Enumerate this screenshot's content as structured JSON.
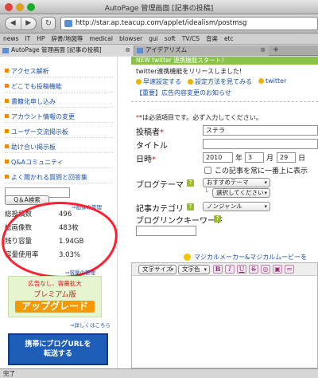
{
  "window": {
    "title": "AutoPage 管理画面 [記事の投稿]"
  },
  "toolbar": {
    "url": "http://star.ap.teacup.com/applet/idealism/postmsg",
    "back": "◀",
    "forward": "▶",
    "reload": "↻"
  },
  "bookmarks": [
    "news",
    "IT",
    "HP",
    "辞書/地図等",
    "medical",
    "blowser",
    "gui",
    "soft",
    "TV/CS",
    "音楽",
    "etc"
  ],
  "tabs": [
    {
      "label": "AutoPage 管理画面 [記事の投稿]",
      "active": true
    },
    {
      "label": "アイデアリズム",
      "active": false
    }
  ],
  "tab_close": "⊗",
  "tab_new": "+",
  "sidebar": {
    "items": [
      "アクセス解析",
      "どこでも投稿機能",
      "書籍化申し込み",
      "アカウント情報の変更",
      "ユーザー交流掲示板",
      "助け合い掲示板",
      "Q&Aコミュニティ",
      "よく聞かれる質問と回答集"
    ],
    "qa_button": "Q＆A検索",
    "back_link": "⇒画像の管理",
    "stats": [
      {
        "label": "総投稿数",
        "value": "496"
      },
      {
        "label": "総画像数",
        "value": "483枚"
      },
      {
        "label": "残り容量",
        "value": "1.94GB"
      },
      {
        "label": "容量使用率",
        "value": "3.03%"
      }
    ],
    "stats_link": "⇒容量の管理",
    "promo": {
      "line1": "広告なし、容量拡大",
      "line2": "プレミアム版",
      "line3": "アップグレード"
    },
    "promo_link": "⇒詳しくはこちら",
    "blue_box": {
      "line1": "携帯にブログURLを",
      "line2": "転送する"
    }
  },
  "main": {
    "twitter_banner": "NEW  twitter  連携機能スタート！",
    "twitter_text": "twitter連携機能をリリースしました!",
    "twitter_links": [
      "早速設定する",
      "設定方法を見てみる",
      "twitter"
    ],
    "notice": "【重要】広告内容変更のお知らせ",
    "required_note": "*は必須項目です。必ず入力してください。",
    "form": {
      "author_label": "投稿者",
      "author_value": "ステラ",
      "title_label": "タイトル",
      "title_value": "",
      "datetime_label": "日時",
      "year": "2010",
      "year_unit": "年",
      "month": "3",
      "month_unit": "月",
      "day": "29",
      "day_unit": "日",
      "pin_label": "この記事を常に一番上に表示",
      "theme_label": "ブログテーマ",
      "theme_select": "おすすめテーマ",
      "theme_sub_select": "選択してください",
      "category_label": "記事カテゴリ",
      "category_select": "ノンジャンル",
      "keyword_label": "ブログリンクキーワード",
      "keyword_value": ""
    },
    "maker_link": "マジカルメーカー&マジカルムービーを",
    "editor": {
      "font_size": "文字サイズ",
      "font_color": "文字色",
      "buttons": [
        "B",
        "I",
        "U",
        "S",
        "◎",
        "▣",
        "⇐"
      ]
    }
  },
  "status": {
    "text": "完了"
  },
  "colors": {
    "annotation": "#ff1f2e",
    "link": "#1a4fa3",
    "twitter_green": "#8bc34a",
    "promo_orange": "#f29a00"
  }
}
